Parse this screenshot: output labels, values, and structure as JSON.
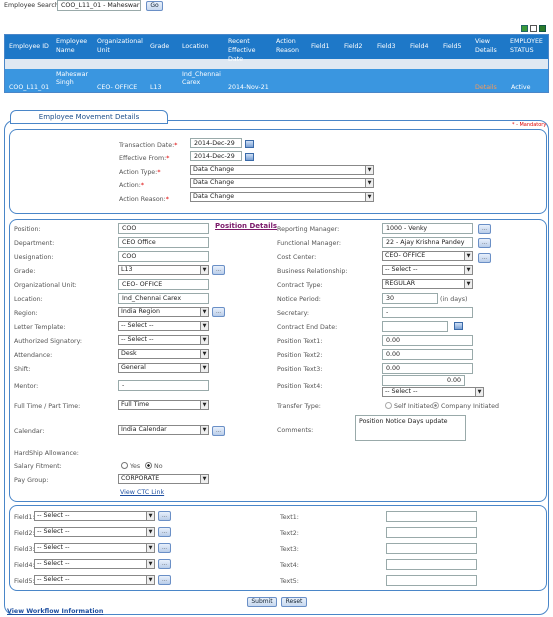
{
  "search": {
    "label": "Employee Search:",
    "value": "COO_L11_01 - Maheswar Sir",
    "go": "Go"
  },
  "table": {
    "headers": [
      "Employee ID",
      "Employee Name",
      "Organizational Unit",
      "Grade",
      "Location",
      "Recent Effective Date",
      "Action Reason",
      "Field1",
      "Field2",
      "Field3",
      "Field4",
      "Field5",
      "View Details",
      "EMPLOYEE STATUS"
    ],
    "row": {
      "id": "COO_L11_01",
      "name": "Maheswar Singh",
      "org": "CEO- OFFICE",
      "grade": "L13",
      "location": "Ind_Chennai Carex",
      "date": "2014-Nov-21",
      "details": "Details",
      "status": "Active"
    }
  },
  "movement": {
    "title": "Employee Movement Details",
    "mandatory": "* - Mandatory",
    "transaction_date": {
      "label": "Transaction Date:",
      "value": "2014-Dec-29"
    },
    "effective_from": {
      "label": "Effective From:",
      "value": "2014-Dec-29"
    },
    "action_type": {
      "label": "Action Type:",
      "value": "Data Change"
    },
    "action": {
      "label": "Action:",
      "value": "Data Change"
    },
    "action_reason": {
      "label": "Action Reason:",
      "value": "Data Change"
    }
  },
  "position": {
    "heading": "Position Details",
    "left": {
      "position": {
        "label": "Position:",
        "value": "COO"
      },
      "department": {
        "label": "Department:",
        "value": "CEO Office"
      },
      "designation": {
        "label": "Uesignation:",
        "value": "COO"
      },
      "grade": {
        "label": "Grade:",
        "value": "L13"
      },
      "org_unit": {
        "label": "Organizational Unit:",
        "value": "CEO- OFFICE"
      },
      "location": {
        "label": "Location:",
        "value": "Ind_Chennai Carex"
      },
      "region": {
        "label": "Region:",
        "value": "India Region"
      },
      "letter_template": {
        "label": "Letter Template:",
        "value": "-- Select --"
      },
      "signatory": {
        "label": "Authorized Signatory:",
        "value": "-- Select --"
      },
      "attendance": {
        "label": "Attendance:",
        "value": "Desk"
      },
      "shift": {
        "label": "Shift:",
        "value": "General"
      },
      "mentor": {
        "label": "Mentor:",
        "value": "-"
      },
      "fulltime": {
        "label": "Full Time / Part Time:",
        "value": "Full Time"
      },
      "calendar": {
        "label": "Calendar:",
        "value": "India Calendar"
      },
      "hardship": {
        "label": "HardShip Allowance:"
      },
      "salary": {
        "label": "Salary Fitment:",
        "yes": "Yes",
        "no": "No"
      },
      "paygroup": {
        "label": "Pay Group:",
        "value": "CORPORATE"
      },
      "ctc_link": "View CTC Link"
    },
    "right": {
      "manager": {
        "label": "Reporting Manager:",
        "value": "1000 - Venky"
      },
      "functional": {
        "label": "Functional Manager:",
        "value": "22 - Ajay Krishna Pandey"
      },
      "cost_center": {
        "label": "Cost Center:",
        "value": "CEO- OFFICE"
      },
      "business": {
        "label": "Business Relationship:",
        "value": "-- Select --"
      },
      "contract": {
        "label": "Contract Type:",
        "value": "REGULAR"
      },
      "notice": {
        "label": "Notice Period:",
        "value": "30",
        "unit": "(in days)"
      },
      "secretary": {
        "label": "Secretary:",
        "value": "-"
      },
      "contract_end": {
        "label": "Contract End Date:",
        "value": ""
      },
      "pt1": {
        "label": "Position Text1:",
        "value": "0.00"
      },
      "pt2": {
        "label": "Position Text2:",
        "value": "0.00"
      },
      "pt3": {
        "label": "Position Text3:",
        "value": "0.00"
      },
      "pt4": {
        "label": "Position Text4:",
        "value": "0.00",
        "select": "-- Select --"
      },
      "transfer": {
        "label": "Transfer Type:",
        "self": "Self Initiated",
        "company": "Company Initiated"
      },
      "comments": {
        "label": "Comments:",
        "value": "Position Notice Days update"
      }
    }
  },
  "fields": {
    "left": [
      {
        "label": "Field1:",
        "value": "-- Select --"
      },
      {
        "label": "Field2:",
        "value": "-- Select --"
      },
      {
        "label": "Field3:",
        "value": "-- Select --"
      },
      {
        "label": "Field4:",
        "value": "-- Select --"
      },
      {
        "label": "Field5:",
        "value": "-- Select --"
      }
    ],
    "right": [
      {
        "label": "Text1:",
        "value": ""
      },
      {
        "label": "Text2:",
        "value": ""
      },
      {
        "label": "Text3:",
        "value": ""
      },
      {
        "label": "Text4:",
        "value": ""
      },
      {
        "label": "Text5:",
        "value": ""
      }
    ]
  },
  "actions": {
    "submit": "Submit",
    "reset": "Reset",
    "workflow": "View Workflow Information"
  },
  "colors": {
    "header_bg": "#1e78c8",
    "row_bg": "#3a96e0",
    "accent": "#4a86c8"
  }
}
